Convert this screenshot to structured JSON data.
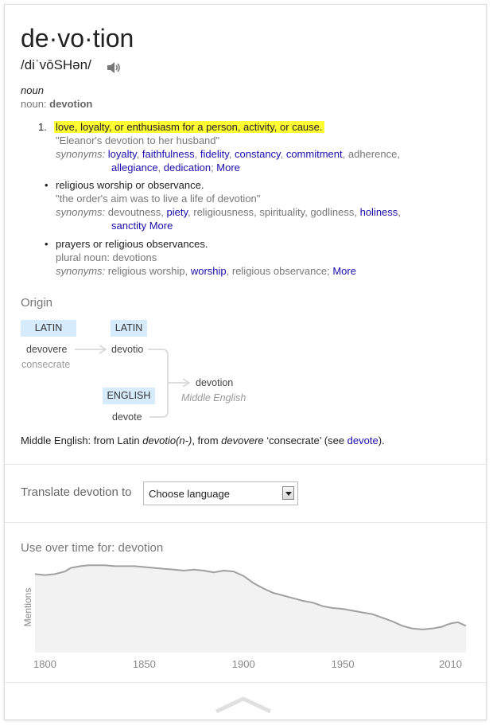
{
  "entry": {
    "word": "de·vo·tion",
    "phonetic": "/diˈvōSHən/",
    "part_of_speech": "noun",
    "noun_label": "noun:",
    "noun_word": "devotion"
  },
  "senses": [
    {
      "number": "1.",
      "definition": "love, loyalty, or enthusiasm for a person, activity, or cause.",
      "example": "\"Eleanor's devotion to her husband\"",
      "synonyms_label": "synonyms:",
      "syn_line1": [
        {
          "text": "loyalty",
          "link": true,
          "sep": ", "
        },
        {
          "text": "faithfulness",
          "link": true,
          "sep": ", "
        },
        {
          "text": "fidelity",
          "link": true,
          "sep": ", "
        },
        {
          "text": "constancy",
          "link": true,
          "sep": ", "
        },
        {
          "text": "commitment",
          "link": true,
          "sep": ", "
        },
        {
          "text": "adherence",
          "link": false,
          "sep": ","
        }
      ],
      "syn_line2": [
        {
          "text": "allegiance",
          "link": true,
          "sep": ", "
        },
        {
          "text": "dedication",
          "link": true,
          "sep": "; "
        }
      ],
      "more": "More"
    },
    {
      "definition": "religious worship or observance.",
      "example": "\"the order's aim was to live a life of devotion\"",
      "synonyms_label": "synonyms:",
      "syn_line1": [
        {
          "text": "devoutness",
          "link": false,
          "sep": ", "
        },
        {
          "text": "piety",
          "link": true,
          "sep": ", "
        },
        {
          "text": "religiousness",
          "link": false,
          "sep": ", "
        },
        {
          "text": "spirituality",
          "link": false,
          "sep": ", "
        },
        {
          "text": "godliness",
          "link": false,
          "sep": ", "
        },
        {
          "text": "holiness",
          "link": true,
          "sep": ","
        }
      ],
      "syn_line2": [
        {
          "text": "sanctity",
          "link": true,
          "sep": " "
        }
      ],
      "more": "More"
    },
    {
      "definition": "prayers or religious observances.",
      "plural": "plural noun: devotions",
      "synonyms_label": "synonyms:",
      "syn_line1": [
        {
          "text": "religious worship",
          "link": false,
          "sep": ", "
        },
        {
          "text": "worship",
          "link": true,
          "sep": ", "
        },
        {
          "text": "religious observance",
          "link": false,
          "sep": ";  "
        }
      ],
      "more": "More"
    }
  ],
  "origin": {
    "title": "Origin",
    "lang_latin": "LATIN",
    "lang_latin2": "LATIN",
    "lang_english": "ENGLISH",
    "devovere": "devovere",
    "consecrate": "consecrate",
    "devotio": "devotio",
    "devote": "devote",
    "devotion": "devotion",
    "middle_english": "Middle English",
    "etym_prefix": "Middle English: from Latin ",
    "etym_devotio": "devotio(n-)",
    "etym_mid": ", from ",
    "etym_devovere": "devovere",
    "etym_consecrate": " ‘consecrate’ (see ",
    "etym_devote": "devote",
    "etym_end": ")."
  },
  "translate": {
    "label": "Translate devotion to",
    "select_value": "Choose language"
  },
  "usage": {
    "title": "Use over time for: devotion"
  },
  "chart_data": {
    "type": "area",
    "title": "Use over time for: devotion",
    "ylabel": "Mentions",
    "xlabel": "",
    "xlim": [
      1795,
      2012
    ],
    "ylim": [
      0,
      1
    ],
    "x_ticks": [
      "1800",
      "1850",
      "1900",
      "1950",
      "2010"
    ],
    "x": [
      1795,
      1800,
      1805,
      1810,
      1813,
      1818,
      1822,
      1826,
      1830,
      1835,
      1840,
      1845,
      1850,
      1855,
      1860,
      1865,
      1870,
      1875,
      1880,
      1885,
      1890,
      1895,
      1900,
      1905,
      1910,
      1915,
      1920,
      1925,
      1930,
      1935,
      1940,
      1945,
      1950,
      1955,
      1960,
      1965,
      1970,
      1975,
      1980,
      1985,
      1990,
      1995,
      2000,
      2002,
      2005,
      2008,
      2010,
      2012
    ],
    "values": [
      0.88,
      0.87,
      0.88,
      0.91,
      0.95,
      0.97,
      0.98,
      0.98,
      0.98,
      0.97,
      0.97,
      0.97,
      0.96,
      0.95,
      0.94,
      0.93,
      0.92,
      0.93,
      0.92,
      0.9,
      0.92,
      0.91,
      0.86,
      0.78,
      0.72,
      0.67,
      0.64,
      0.61,
      0.58,
      0.56,
      0.52,
      0.5,
      0.49,
      0.47,
      0.45,
      0.43,
      0.39,
      0.35,
      0.3,
      0.27,
      0.26,
      0.27,
      0.29,
      0.31,
      0.33,
      0.34,
      0.32,
      0.3
    ],
    "color": "#a0a0a0",
    "fill": "#f2f2f2"
  },
  "footer": {
    "collapse_icon": "chevron-up-icon"
  }
}
